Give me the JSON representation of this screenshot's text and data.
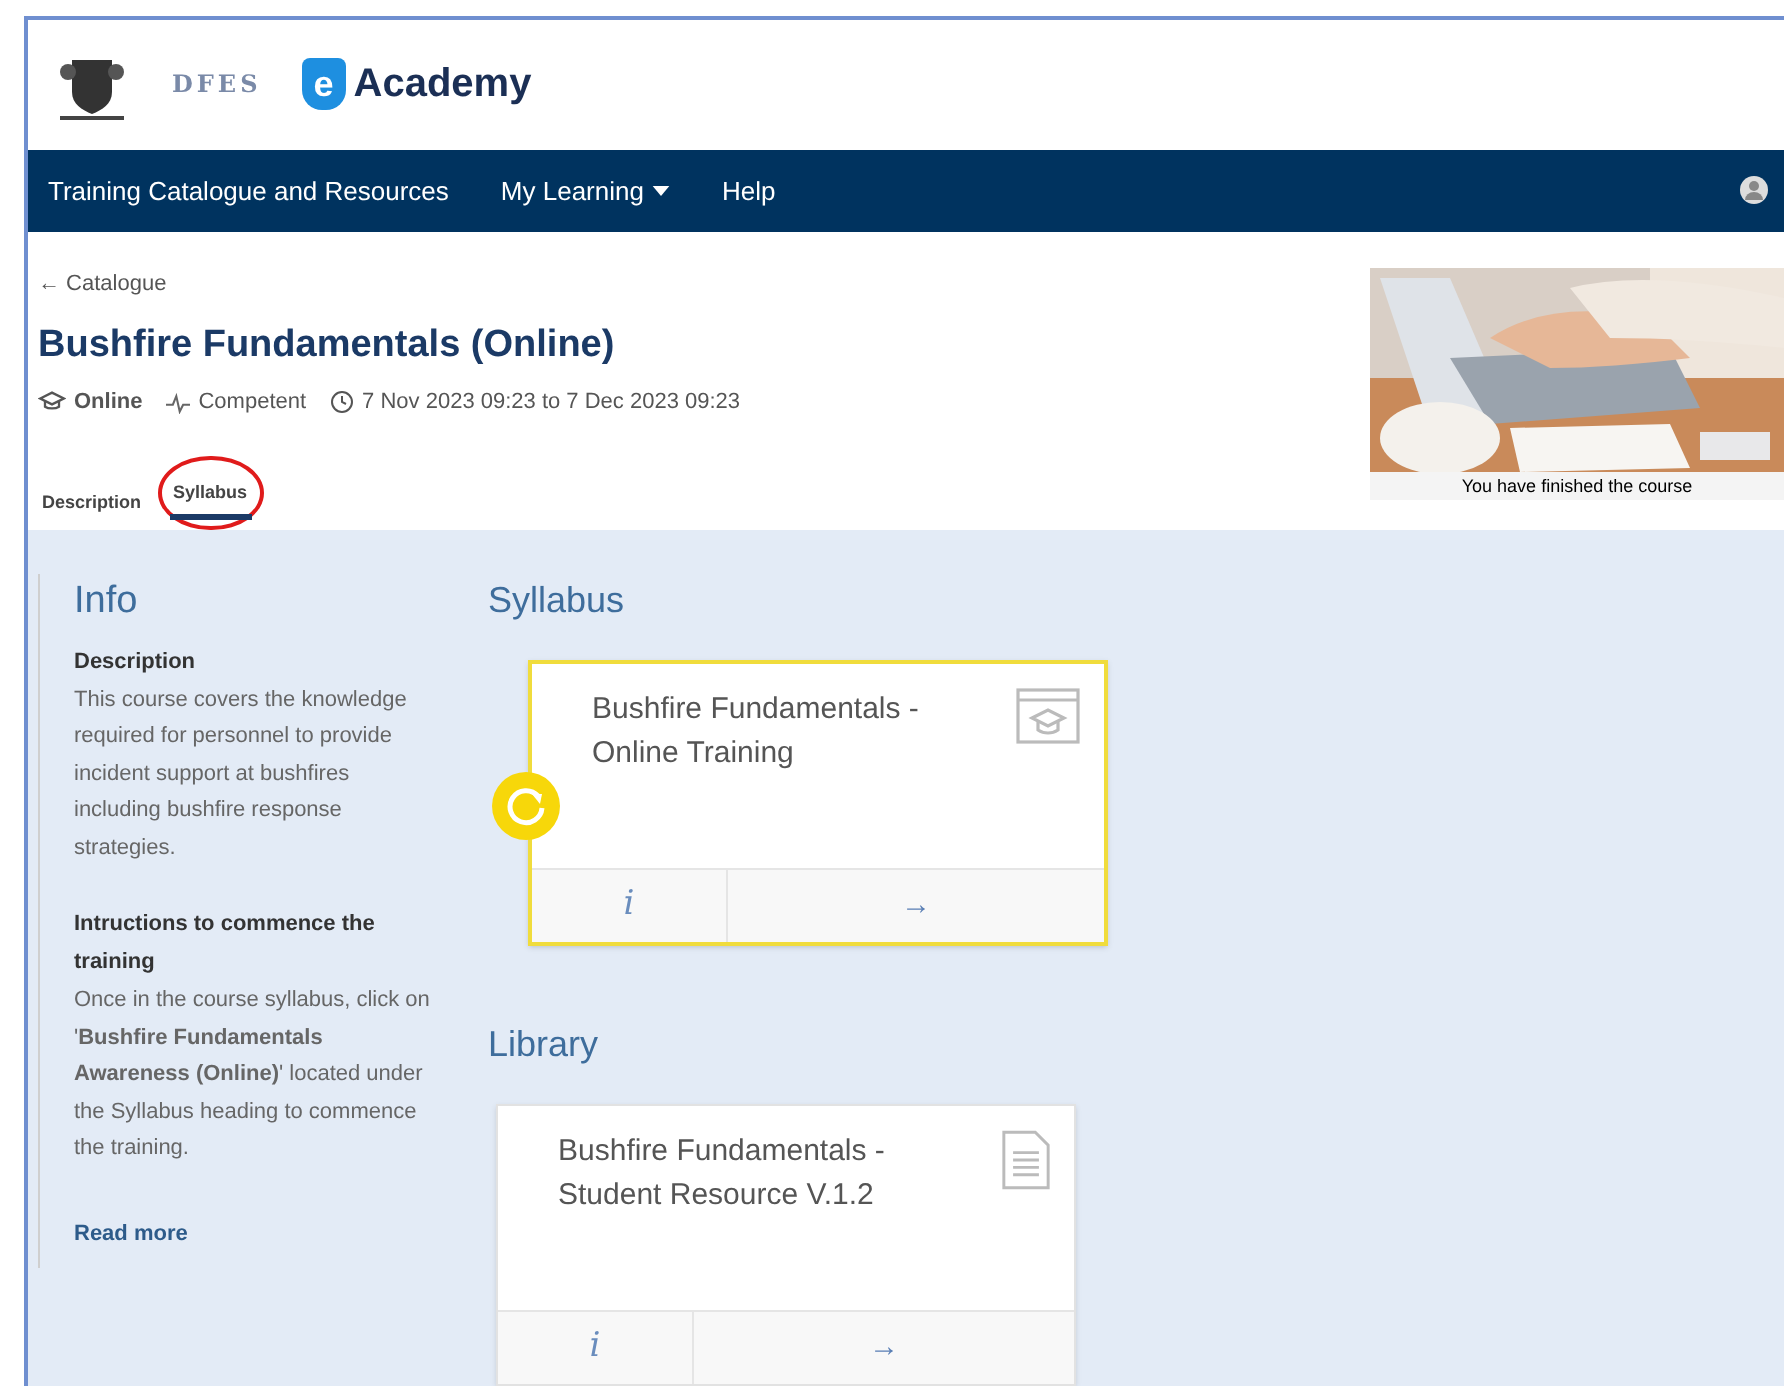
{
  "header": {
    "brand": "Academy",
    "brand_mark": "e",
    "agency": "DFES"
  },
  "nav": {
    "items": [
      {
        "label": "Training Catalogue and Resources",
        "dropdown": false
      },
      {
        "label": "My Learning",
        "dropdown": true
      },
      {
        "label": "Help",
        "dropdown": false
      }
    ]
  },
  "back_link": "← Catalogue",
  "course": {
    "title": "Bushfire Fundamentals (Online)",
    "mode": "Online",
    "result": "Competent",
    "dates": "7 Nov 2023 09:23 to 7 Dec 2023 09:23"
  },
  "tabs": [
    {
      "label": "Description",
      "selected": false,
      "circled": false
    },
    {
      "label": "Syllabus",
      "selected": true,
      "circled": true
    }
  ],
  "banner": {
    "caption": "You have finished the course"
  },
  "info": {
    "heading": "Info",
    "sections": [
      {
        "heading": "Description",
        "text": "This course covers the knowledge required for personnel to provide incident support at bushfires including bushfire response strategies."
      },
      {
        "heading": "Intructions to commence the training",
        "text": "Once in the course syllabus, click on '**Bushfire Fundamentals Awareness (Online)**' located under the Syllabus heading to commence the training."
      }
    ],
    "read_more": "Read more"
  },
  "syllabus": {
    "heading": "Syllabus",
    "cards": [
      {
        "title": "Bushfire Fundamentals - Online Training",
        "kind": "course",
        "in_progress": true,
        "info": "i",
        "go": "→"
      }
    ]
  },
  "library": {
    "heading": "Library",
    "cards": [
      {
        "title": "Bushfire Fundamentals - Student Resource V.1.2",
        "kind": "document",
        "in_progress": false,
        "info": "i",
        "go": "→"
      }
    ]
  }
}
